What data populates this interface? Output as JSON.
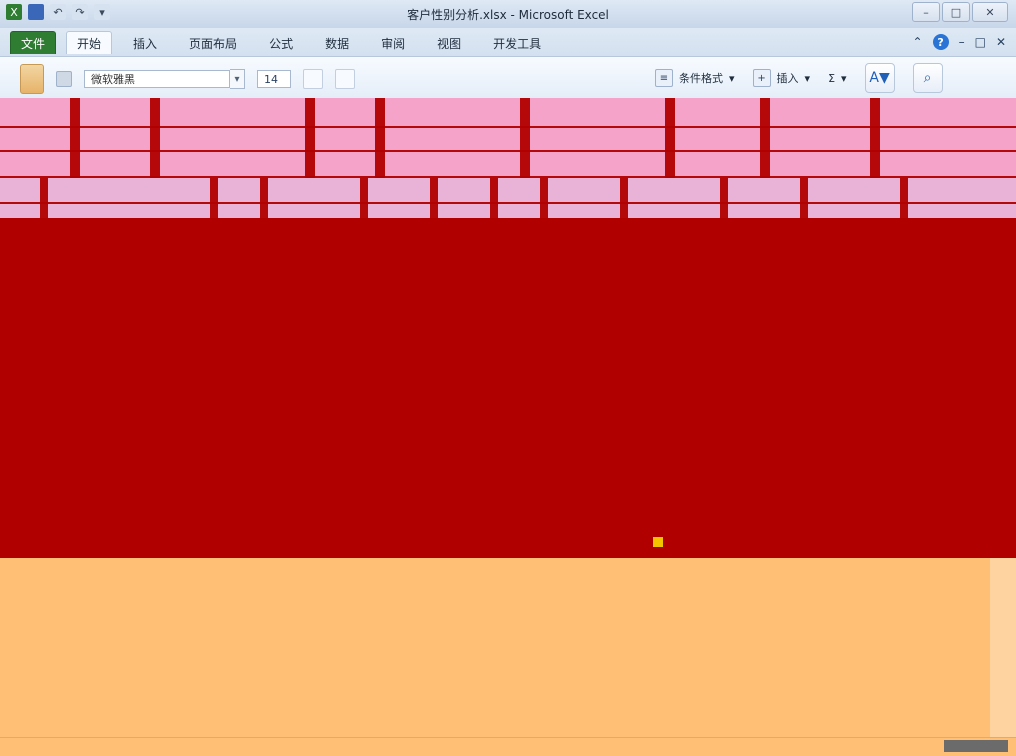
{
  "window": {
    "title": "客户性别分析.xlsx - Microsoft Excel"
  },
  "quick_access": {
    "excel_icon": "X",
    "undo_label": "↶",
    "redo_label": "↷",
    "more_label": "▾"
  },
  "ribbon_tabs": [
    {
      "label": "文件"
    },
    {
      "label": "开始"
    },
    {
      "label": "插入"
    },
    {
      "label": "页面布局"
    },
    {
      "label": "公式"
    },
    {
      "label": "数据"
    },
    {
      "label": "审阅"
    },
    {
      "label": "视图"
    },
    {
      "label": "开发工具"
    }
  ],
  "ribbon": {
    "font_name": "微软雅黑",
    "font_size": "14",
    "conditional_format": "条件格式",
    "insert": "插入",
    "autosum": "Σ",
    "sort_filter": "A▼"
  },
  "window_controls": {
    "minimize": "–",
    "maximize": "□",
    "close": "✕"
  },
  "colors": {
    "excel_green": "#2f7d32",
    "accent_red": "#b00000",
    "pink": "#f5a3c9",
    "orange": "#ffbf74"
  }
}
